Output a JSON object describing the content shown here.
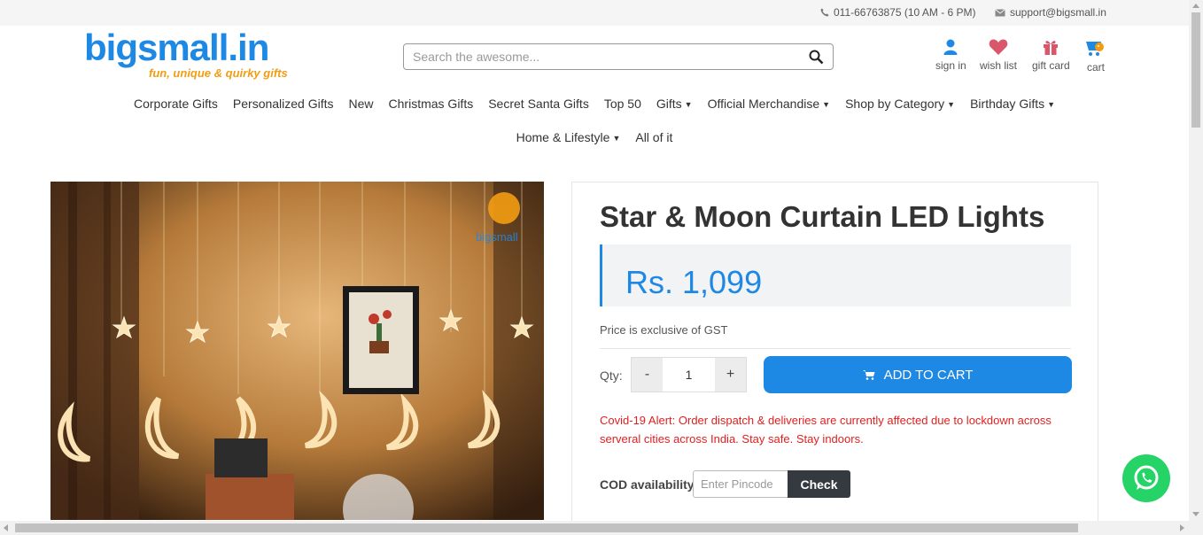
{
  "topbar": {
    "phone": "011-66763875 (10 AM - 6 PM)",
    "email": "support@bigsmall.in"
  },
  "logo": {
    "brand": "bigsmall.in",
    "tagline": "fun, unique & quirky gifts"
  },
  "search": {
    "placeholder": "Search the awesome..."
  },
  "header_icons": {
    "sign_in": "sign in",
    "wish_list": "wish list",
    "gift_card": "gift card",
    "cart": "cart"
  },
  "nav": {
    "row1": [
      {
        "label": "Corporate Gifts",
        "dropdown": false
      },
      {
        "label": "Personalized Gifts",
        "dropdown": false
      },
      {
        "label": "New",
        "dropdown": false
      },
      {
        "label": "Christmas Gifts",
        "dropdown": false
      },
      {
        "label": "Secret Santa Gifts",
        "dropdown": false
      },
      {
        "label": "Top 50",
        "dropdown": false
      },
      {
        "label": "Gifts",
        "dropdown": true
      },
      {
        "label": "Official Merchandise",
        "dropdown": true
      },
      {
        "label": "Shop by Category",
        "dropdown": true
      },
      {
        "label": "Birthday Gifts",
        "dropdown": true
      }
    ],
    "row2": [
      {
        "label": "Home & Lifestyle",
        "dropdown": true
      },
      {
        "label": "All of it",
        "dropdown": false
      }
    ]
  },
  "product": {
    "title": "Star & Moon Curtain LED Lights",
    "price": "Rs. 1,099",
    "gst_note": "Price is exclusive of GST",
    "qty_label": "Qty:",
    "qty_minus": "-",
    "qty_value": "1",
    "qty_plus": "+",
    "add_to_cart": "ADD TO CART",
    "alert": "Covid-19 Alert: Order dispatch & deliveries are currently affected due to lockdown across serveral cities across India. Stay safe. Stay indoors.",
    "cod_label": "COD availability",
    "pincode_placeholder": "Enter Pincode",
    "check_label": "Check"
  },
  "colors": {
    "accent": "#1e88e5",
    "alert": "#e31e1e",
    "whatsapp": "#25d366",
    "tagline": "#f39c12"
  }
}
